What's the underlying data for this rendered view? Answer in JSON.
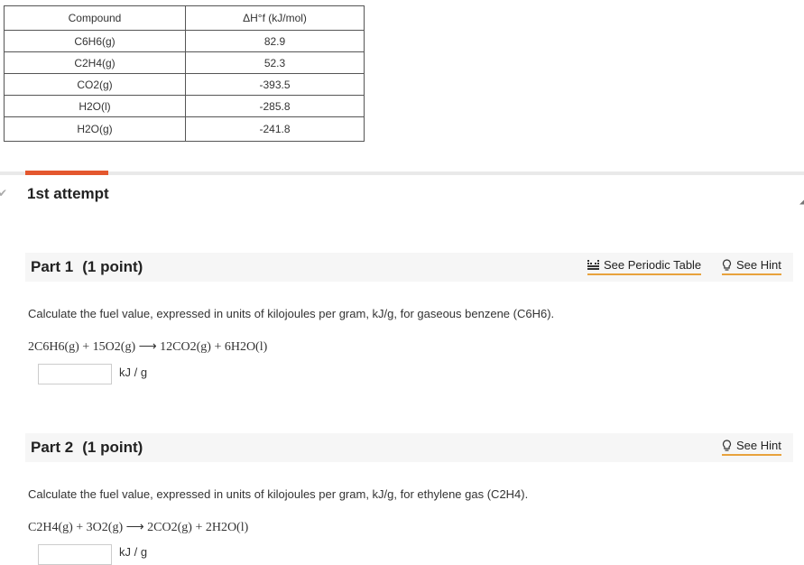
{
  "table": {
    "header": [
      "Compound",
      "ΔH°f (kJ/mol)"
    ],
    "rows": [
      [
        "C6H6(g)",
        "82.9"
      ],
      [
        "C2H4(g)",
        "52.3"
      ],
      [
        "CO2(g)",
        "-393.5"
      ],
      [
        "H2O(l)",
        "-285.8"
      ],
      [
        "H2O(g)",
        "-241.8"
      ]
    ]
  },
  "attempt_label": "1st attempt",
  "part1": {
    "title": "Part 1",
    "points": "(1 point)",
    "periodic_link": "See Periodic Table",
    "hint_link": "See Hint",
    "question": "Calculate the fuel value, expressed in units of kilojoules per gram, kJ/g, for gaseous benzene (C6H6).",
    "equation": "2C6H6(g) + 15O2(g) ⟶ 12CO2(g) + 6H2O(l)",
    "answer_value": "",
    "unit": "kJ / g"
  },
  "part2": {
    "title": "Part 2",
    "points": "(1 point)",
    "hint_link": "See Hint",
    "question": "Calculate the fuel value, expressed in units of kilojoules per gram, kJ/g, for ethylene gas (C2H4).",
    "equation": "C2H4(g) + 3O2(g) ⟶ 2CO2(g) + 2H2O(l)",
    "answer_value": "",
    "unit": "kJ / g"
  },
  "colors": {
    "accent_tab": "#e4572e",
    "link_underline": "#e8a23c",
    "part_bar": "#f6f6f6"
  },
  "icons": {
    "periodic": "periodic-table-icon",
    "hint": "lightbulb-icon"
  }
}
